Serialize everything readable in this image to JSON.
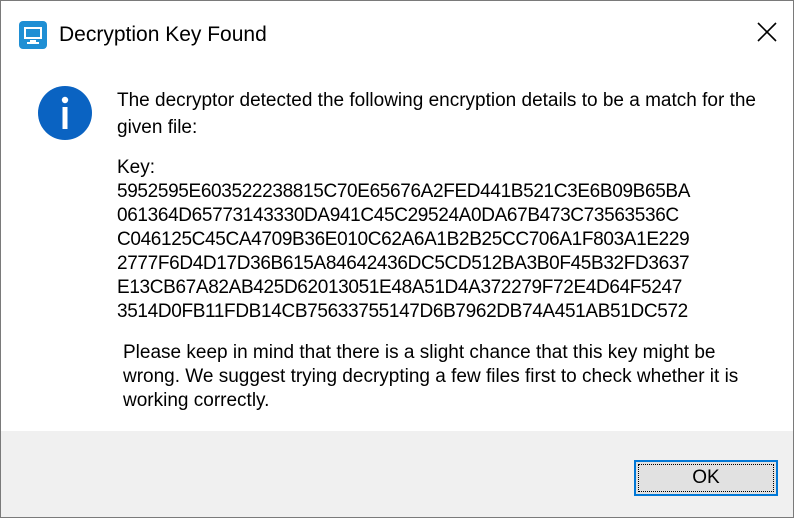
{
  "window": {
    "title": "Decryption Key Found",
    "app_icon": "monitor-app-icon",
    "close_icon": "close-icon",
    "close_glyph": "✕"
  },
  "content": {
    "info_icon": "info-icon",
    "info_color": "#0a63c2",
    "message": "The decryptor detected the following encryption details to be a match for the given file:",
    "key_label": "Key:",
    "key_lines": [
      "5952595E603522238815C70E65676A2FED441B521C3E6B09B65BA",
      "061364D65773143330DA941C45C29524A0DA67B473C73563536C",
      "C046125C45CA4709B36E010C62A6A1B2B25CC706A1F803A1E229",
      "2777F6D4D17D36B615A84642436DC5CD512BA3B0F45B32FD3637",
      "E13CB67A82AB425D62013051E48A51D4A372279F72E4D64F5247",
      "3514D0FB11FDB14CB75633755147D6B7962DB74A451AB51DC572"
    ],
    "warning": "Please keep in mind that there is a slight chance that this key might be wrong. We suggest trying decrypting a few files first to check whether it is working correctly."
  },
  "footer": {
    "ok_label": "OK",
    "accent_color": "#0078d7"
  }
}
